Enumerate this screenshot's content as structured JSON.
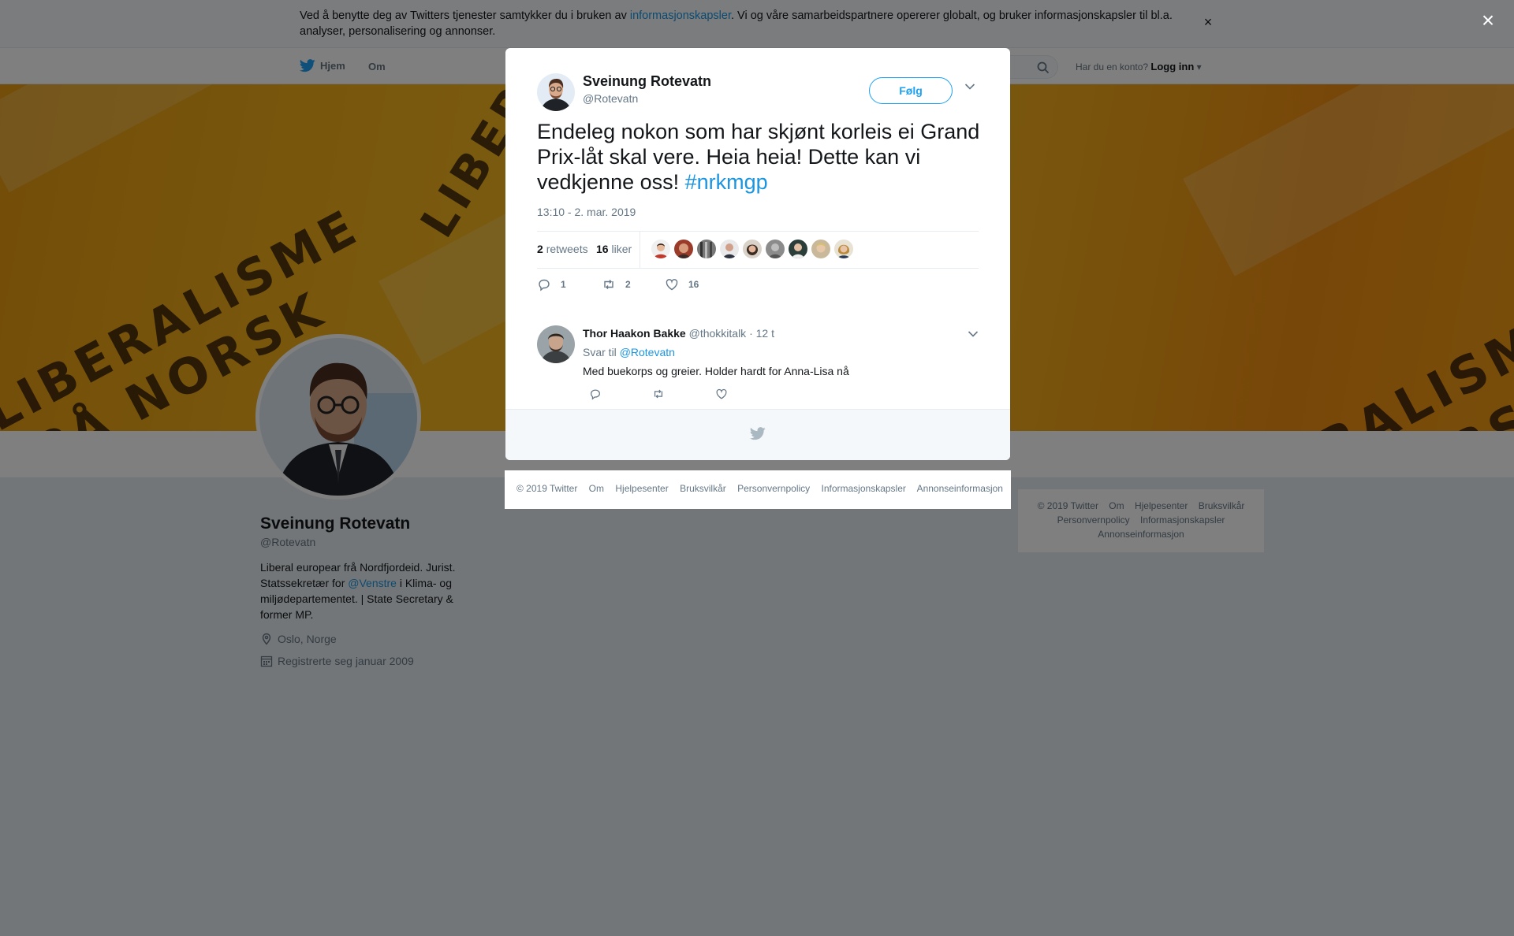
{
  "cookie_bar": {
    "text_before": "Ved å benytte deg av Twitters tjenester samtykker du i bruken av ",
    "link": "informasjonskapsler",
    "text_after": ". Vi og våre samarbeidspartnere opererer globalt, og bruker informasjonskapsler til bl.a. analyser, personalisering og annonser.",
    "close": "×"
  },
  "nav": {
    "home": "Hjem",
    "about": "Om",
    "account_prompt": "Har du en konto?",
    "login": "Logg inn"
  },
  "banner_words": [
    "LIBERALISME",
    "PÅ NORSK"
  ],
  "profile": {
    "name": "Sveinung Rotevatn",
    "handle": "@Rotevatn",
    "bio_before": "Liberal europear frå Nordfjordeid. Jurist. Statssekretær for ",
    "bio_link": "@Venstre",
    "bio_after": " i Klima- og miljødepartementet. | State Secretary & former MP.",
    "location": "Oslo, Norge",
    "joined": "Registrerte seg januar 2009"
  },
  "side_footer": [
    "© 2019 Twitter",
    "Om",
    "Hjelpesenter",
    "Bruksvilkår",
    "Personvernpolicy",
    "Informasjonskapsler",
    "Annonseinformasjon"
  ],
  "overlay_close": "×",
  "tweet": {
    "author_name": "Sveinung Rotevatn",
    "author_handle": "@Rotevatn",
    "follow_label": "Følg",
    "text": "Endeleg nokon som har skjønt korleis ei Grand Prix-låt skal vere. Heia heia! Dette kan vi vedkjenne oss! ",
    "hashtag": "#nrkmgp",
    "timestamp": "13:10 - 2. mar. 2019",
    "retweets_count": "2",
    "retweets_label": "retweets",
    "likes_count": "16",
    "likes_label": "liker",
    "reply_count": "1",
    "retweet_action_count": "2",
    "like_action_count": "16"
  },
  "reply": {
    "name": "Thor Haakon Bakke",
    "handle": "@thokkitalk",
    "time": "· 12 t",
    "reply_to_label": "Svar til",
    "reply_to_handle": "@Rotevatn",
    "text": "Med buekorps og greier. Holder hardt for Anna-Lisa nå"
  },
  "modal_footer": [
    "© 2019 Twitter",
    "Om",
    "Hjelpesenter",
    "Bruksvilkår",
    "Personvernpolicy",
    "Informasjonskapsler",
    "Annonseinformasjon"
  ],
  "colors": {
    "accent": "#1da1f2",
    "link": "#1b95e0",
    "text": "#14171a",
    "muted": "#657786",
    "overlay": "rgba(0,0,0,0.5)"
  }
}
